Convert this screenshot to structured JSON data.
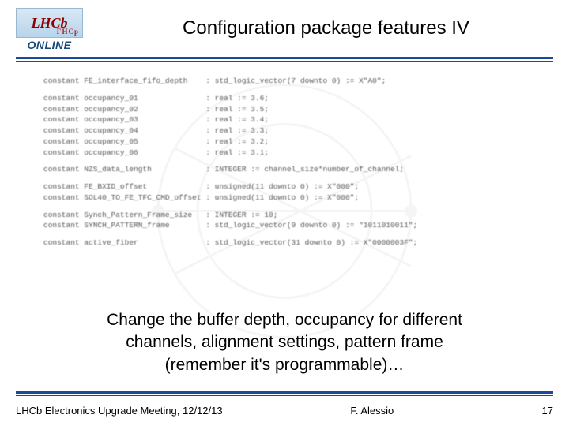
{
  "logo": {
    "top": "LHCb",
    "overlay": "ГНСр",
    "bottom": "ONLINE"
  },
  "title": "Configuration package features IV",
  "code": {
    "l00": "constant FE_interface_fifo_depth    : std_logic_vector(7 downto 0) := X\"A0\";",
    "l01": "constant occupancy_01               : real := 3.6;",
    "l02": "constant occupancy_02               : real := 3.5;",
    "l03": "constant occupancy_03               : real := 3.4;",
    "l04": "constant occupancy_04               : real := 3.3;",
    "l05": "constant occupancy_05               : real := 3.2;",
    "l06": "constant occupancy_06               : real := 3.1;",
    "l07": "constant NZS_data_length            : INTEGER := channel_size*number_of_channel;",
    "l08": "constant FE_BXID_offset             : unsigned(11 downto 0) := X\"000\";",
    "l09": "constant SOL40_TO_FE_TFC_CMD_offset : unsigned(11 downto 0) := X\"000\";",
    "l10": "constant Synch_Pattern_Frame_size   : INTEGER := 10;",
    "l11": "constant SYNCH_PATTERN_frame        : std_logic_vector(9 downto 0) := \"1011010011\";",
    "l12": "constant active_fiber               : std_logic_vector(31 downto 0) := X\"0000003F\";"
  },
  "caption": {
    "line1": "Change the buffer depth, occupancy for different",
    "line2": "channels, alignment settings, pattern frame",
    "line3": "(remember it's programmable)…"
  },
  "footer": {
    "left": "LHCb Electronics Upgrade Meeting, 12/12/13",
    "center": "F. Alessio",
    "page": "17"
  }
}
